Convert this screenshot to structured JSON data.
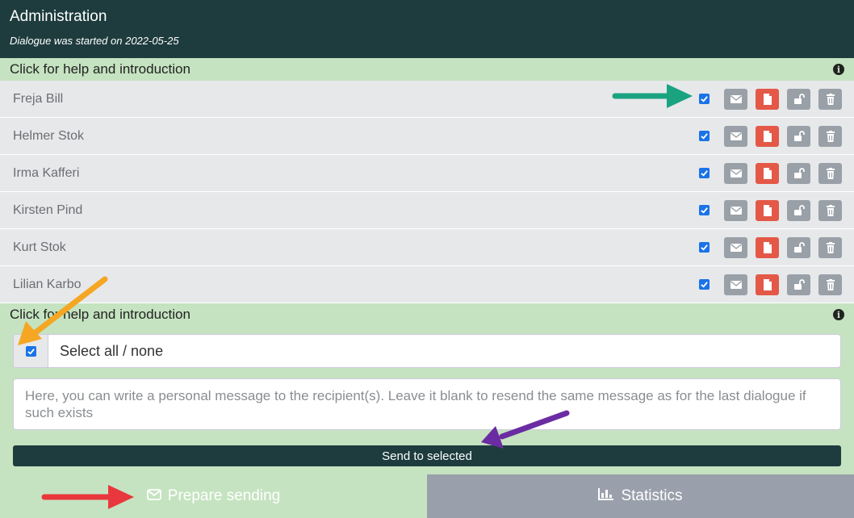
{
  "header": {
    "title": "Administration",
    "subtitle": "Dialogue was started on 2022-05-25"
  },
  "help": {
    "label": "Click for help and introduction"
  },
  "recipients": [
    {
      "name": "Freja Bill",
      "checked": true
    },
    {
      "name": "Helmer Stok",
      "checked": true
    },
    {
      "name": "Irma Kafferi",
      "checked": true
    },
    {
      "name": "Kirsten Pind",
      "checked": true
    },
    {
      "name": "Kurt Stok",
      "checked": true
    },
    {
      "name": "Lilian Karbo",
      "checked": true
    }
  ],
  "selection": {
    "label": "Select all / none",
    "checked": true
  },
  "message": {
    "placeholder": "Here, you can write a personal message to the recipient(s). Leave it blank to resend the same message as for the last dialogue if such exists",
    "value": ""
  },
  "send_button": "Send to selected",
  "tabs": {
    "prepare": "Prepare sending",
    "statistics": "Statistics"
  },
  "icons": {
    "info": "info-icon",
    "email": "envelope-icon",
    "pdf": "file-icon",
    "unlock": "unlock-icon",
    "delete": "trash-icon",
    "statistics": "bar-chart-icon"
  },
  "colors": {
    "header_bg": "#1e3c3e",
    "accent_green": "#c5e3c0",
    "row_bg": "#e7e8ea",
    "button_grey": "#9aa0a8",
    "button_red": "#e45847",
    "checkbox_blue": "#1a73e8",
    "annotation_arrows": [
      "#1aa381",
      "#f5a623",
      "#6b2ca3",
      "#e8383d"
    ]
  }
}
